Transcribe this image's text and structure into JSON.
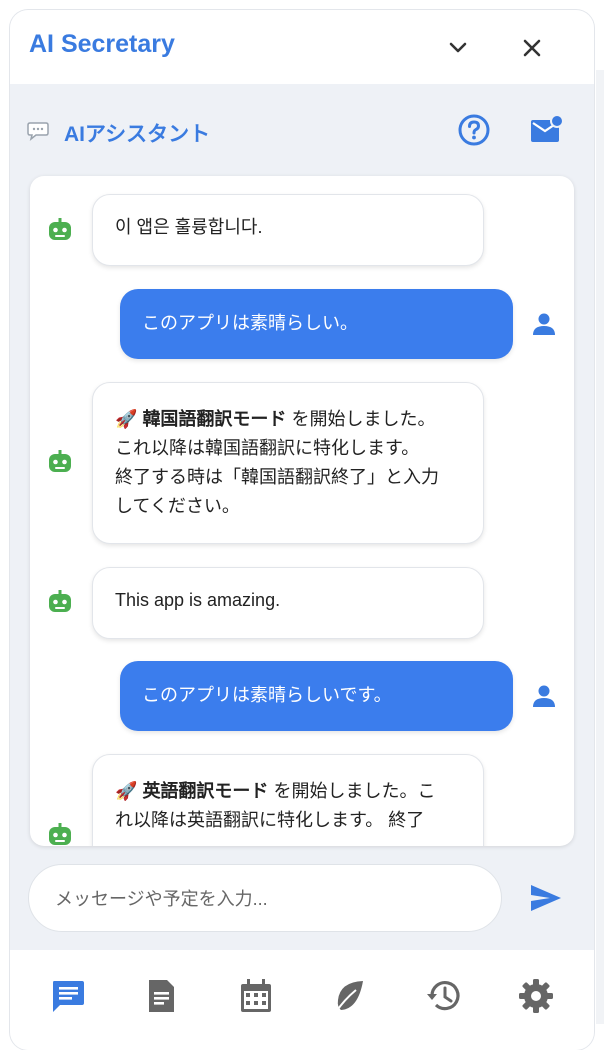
{
  "app": {
    "title": "AI Secretary"
  },
  "header": {
    "title": "AIアシスタント",
    "help_icon": "help-circle-icon",
    "mail_icon": "mail-notification-icon"
  },
  "messages": [
    {
      "role": "bot",
      "lines": [
        "이 앱은 훌륭합니다."
      ]
    },
    {
      "role": "user",
      "lines": [
        "このアプリは素晴らしい。"
      ]
    },
    {
      "role": "bot",
      "emoji": "🚀",
      "bold": "韓国語翻訳モード",
      "lines": [
        " を開始しました。",
        "これ以降は韓国語翻訳に特化します。",
        "終了する時は「韓国語翻訳終了」と入力",
        "してください。"
      ]
    },
    {
      "role": "bot",
      "lines": [
        "This app is amazing."
      ]
    },
    {
      "role": "user",
      "lines": [
        "このアプリは素晴らしいです。"
      ]
    },
    {
      "role": "bot",
      "emoji": "🚀",
      "bold": "英語翻訳モード",
      "lines": [
        " を開始しました。こ",
        "れ以降は英語翻訳に特化します。 終了"
      ]
    }
  ],
  "input": {
    "placeholder": "メッセージや予定を入力..."
  },
  "nav": [
    "chat-icon",
    "document-icon",
    "calendar-icon",
    "leaf-icon",
    "history-icon",
    "settings-icon"
  ],
  "colors": {
    "accent": "#3a7be0",
    "user_bubble": "#3b7ded",
    "bot_icon": "#4caf50",
    "nav_active": "#3a7be0",
    "nav_inactive": "#666666"
  }
}
